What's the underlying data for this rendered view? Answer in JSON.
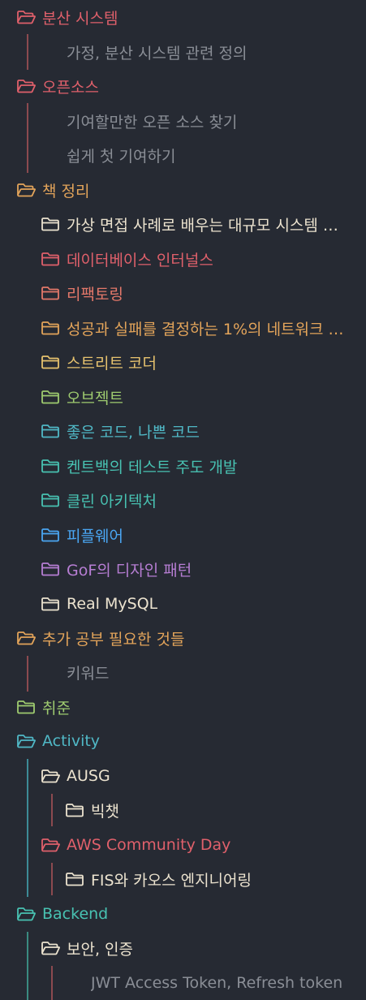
{
  "colors": {
    "background": "#262a33",
    "red": "#e0606b",
    "salmon": "#e4786a",
    "orange": "#e3a45a",
    "yellow": "#e6c26e",
    "green": "#9ecb6f",
    "cyan": "#50b8c6",
    "teal": "#48c2b2",
    "blue": "#4aa6f2",
    "purple": "#b77ed4",
    "cream": "#ece3cf",
    "file_text": "#8a8e96",
    "guide_red": "#8c4a4f",
    "guide_cyan": "#3d8a96",
    "guide_teal": "#3a8a80"
  },
  "tree": {
    "items": [
      {
        "type": "folder",
        "label": "분산 시스템",
        "color": "red",
        "icon": "folder-open-icon"
      },
      {
        "type": "file",
        "label": "가정, 분산 시스템 관련 정의"
      },
      {
        "type": "folder",
        "label": "오픈소스",
        "color": "red",
        "icon": "folder-open-icon"
      },
      {
        "type": "file",
        "label": "기여할만한 오픈 소스 찾기"
      },
      {
        "type": "file",
        "label": "쉽게 첫 기여하기"
      },
      {
        "type": "folder",
        "label": "책 정리",
        "color": "orange",
        "icon": "folder-open-icon"
      },
      {
        "type": "folder",
        "label": "가상 면접 사례로 배우는 대규모 시스템 …",
        "color": "cream",
        "icon": "folder-icon"
      },
      {
        "type": "folder",
        "label": "데이터베이스 인터널스",
        "color": "red",
        "icon": "folder-icon"
      },
      {
        "type": "folder",
        "label": "리팩토링",
        "color": "salmon",
        "icon": "folder-icon"
      },
      {
        "type": "folder",
        "label": "성공과 실패를 결정하는 1%의 네트워크 …",
        "color": "orange",
        "icon": "folder-icon"
      },
      {
        "type": "folder",
        "label": "스트리트 코더",
        "color": "yellow",
        "icon": "folder-icon"
      },
      {
        "type": "folder",
        "label": "오브젝트",
        "color": "green",
        "icon": "folder-icon"
      },
      {
        "type": "folder",
        "label": "좋은 코드, 나쁜 코드",
        "color": "cyan",
        "icon": "folder-icon"
      },
      {
        "type": "folder",
        "label": "켄트백의 테스트 주도 개발",
        "color": "teal",
        "icon": "folder-icon"
      },
      {
        "type": "folder",
        "label": "클린 아키텍처",
        "color": "teal",
        "icon": "folder-icon"
      },
      {
        "type": "folder",
        "label": "피플웨어",
        "color": "blue",
        "icon": "folder-icon"
      },
      {
        "type": "folder",
        "label": "GoF의 디자인 패턴",
        "color": "purple",
        "icon": "folder-icon"
      },
      {
        "type": "folder",
        "label": "Real MySQL",
        "color": "cream",
        "icon": "folder-icon"
      },
      {
        "type": "folder",
        "label": "추가 공부 필요한 것들",
        "color": "orange",
        "icon": "folder-open-icon"
      },
      {
        "type": "file",
        "label": "키워드"
      },
      {
        "type": "folder",
        "label": "취준",
        "color": "green",
        "icon": "folder-icon"
      },
      {
        "type": "folder",
        "label": "Activity",
        "color": "cyan",
        "icon": "folder-open-icon"
      },
      {
        "type": "folder",
        "label": "AUSG",
        "color": "cream",
        "icon": "folder-open-icon"
      },
      {
        "type": "folder",
        "label": "빅챗",
        "color": "cream",
        "icon": "folder-icon"
      },
      {
        "type": "folder",
        "label": "AWS Community Day",
        "color": "red",
        "icon": "folder-open-icon"
      },
      {
        "type": "folder",
        "label": "FIS와 카오스 엔지니어링",
        "color": "cream",
        "icon": "folder-icon"
      },
      {
        "type": "folder",
        "label": "Backend",
        "color": "teal",
        "icon": "folder-open-icon"
      },
      {
        "type": "folder",
        "label": "보안, 인증",
        "color": "cream",
        "icon": "folder-open-icon"
      },
      {
        "type": "file",
        "label": "JWT Access Token, Refresh token"
      }
    ]
  }
}
